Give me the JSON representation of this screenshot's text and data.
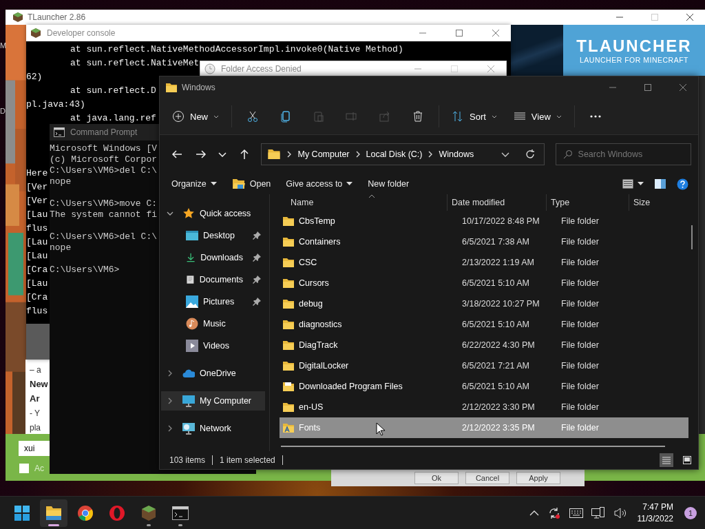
{
  "desktop": {
    "labels": [
      "M",
      "D"
    ]
  },
  "launcher": {
    "title": "TLauncher 2.86",
    "logo": {
      "title": "TLAUNCHER",
      "subtitle": "LAUNCHER FOR MINECRAFT"
    },
    "news": [
      {
        "text": "– a",
        "kind": "body"
      },
      {
        "text": "New",
        "kind": "heading"
      },
      {
        "text": "Ar",
        "kind": "heading"
      },
      {
        "text": "- Y",
        "kind": "body"
      },
      {
        "text": "pla",
        "kind": "body"
      }
    ],
    "nickname_field": {
      "value": "xui"
    },
    "account_checkbox": {
      "label": "Ac",
      "checked": false
    }
  },
  "properties_dialog": {
    "buttons": [
      "Ok",
      "Cancel",
      "Apply"
    ]
  },
  "dev_console": {
    "title": "Developer console",
    "upper_lines": [
      {
        "text": "at sun.reflect.NativeMethodAccessorImpl.invoke0(Native Method)",
        "kind": "trace"
      },
      {
        "text": "at sun.reflect.NativeMet",
        "kind": "trace"
      },
      {
        "text": "62)",
        "kind": "plain"
      },
      {
        "text": "at sun.reflect.D",
        "kind": "trace"
      },
      {
        "text": "pl.java:43)",
        "kind": "plain"
      },
      {
        "text": "at java.lang.ref",
        "kind": "trace"
      }
    ],
    "lower_lines": [
      "Here",
      "[Ver",
      "[Ver",
      "[Lau",
      "flus",
      "[Lau",
      "[Lau",
      "[Cra",
      "[Lau",
      "[Cra",
      "flus"
    ]
  },
  "access_dialog": {
    "title": "Folder Access Denied"
  },
  "cmd": {
    "title": "Command Prompt",
    "blocks": [
      [
        "Microsoft Windows [V",
        "(c) Microsoft Corpor",
        "C:\\Users\\VM6>del C:\\",
        "nope"
      ],
      [
        "C:\\Users\\VM6>move C:",
        "The system cannot fi"
      ],
      [
        "C:\\Users\\VM6>del C:\\",
        "nope"
      ],
      [
        "C:\\Users\\VM6>"
      ]
    ]
  },
  "explorer": {
    "title": "Windows",
    "toolbar": [
      {
        "kind": "new",
        "label": "New",
        "disabled": false
      },
      {
        "kind": "cut",
        "disabled": false
      },
      {
        "kind": "copy",
        "disabled": false
      },
      {
        "kind": "paste",
        "disabled": true
      },
      {
        "kind": "rename",
        "disabled": true
      },
      {
        "kind": "share",
        "disabled": true
      },
      {
        "kind": "delete",
        "disabled": false
      },
      {
        "kind": "sort",
        "label": "Sort",
        "disabled": false
      },
      {
        "kind": "view",
        "label": "View",
        "disabled": false
      },
      {
        "kind": "more",
        "disabled": false
      }
    ],
    "breadcrumb": [
      "My Computer",
      "Local Disk (C:)",
      "Windows"
    ],
    "search": {
      "placeholder": "Search Windows"
    },
    "commands": [
      {
        "label": "Organize",
        "kind": "dropdown"
      },
      {
        "label": "Open",
        "kind": "open"
      },
      {
        "label": "Give access to",
        "kind": "dropdown"
      },
      {
        "label": "New folder",
        "kind": "action"
      }
    ],
    "nav": [
      {
        "label": "Quick access",
        "kind": "quick-access",
        "expanded": true,
        "selected": false,
        "children": [
          {
            "label": "Desktop",
            "kind": "desktop",
            "pinned": true,
            "selected": false
          },
          {
            "label": "Downloads",
            "kind": "downloads",
            "pinned": true,
            "selected": false
          },
          {
            "label": "Documents",
            "kind": "documents",
            "pinned": true,
            "selected": false
          },
          {
            "label": "Pictures",
            "kind": "pictures",
            "pinned": true,
            "selected": false
          },
          {
            "label": "Music",
            "kind": "music",
            "pinned": false,
            "selected": false
          },
          {
            "label": "Videos",
            "kind": "videos",
            "pinned": false,
            "selected": false
          }
        ]
      },
      {
        "label": "OneDrive",
        "kind": "onedrive",
        "expanded": false,
        "selected": false
      },
      {
        "label": "My Computer",
        "kind": "computer",
        "expanded": false,
        "selected": true
      },
      {
        "label": "Network",
        "kind": "network",
        "expanded": false,
        "selected": false
      }
    ],
    "columns": [
      "Name",
      "Date modified",
      "Type",
      "Size"
    ],
    "files": [
      {
        "name": "CbsTemp",
        "modified": "10/17/2022 8:48 PM",
        "type": "File folder",
        "kind": "folder",
        "selected": false
      },
      {
        "name": "Containers",
        "modified": "6/5/2021 7:38 AM",
        "type": "File folder",
        "kind": "folder",
        "selected": false
      },
      {
        "name": "CSC",
        "modified": "2/13/2022 1:19 AM",
        "type": "File folder",
        "kind": "folder",
        "selected": false
      },
      {
        "name": "Cursors",
        "modified": "6/5/2021 5:10 AM",
        "type": "File folder",
        "kind": "folder",
        "selected": false
      },
      {
        "name": "debug",
        "modified": "3/18/2022 10:27 PM",
        "type": "File folder",
        "kind": "folder",
        "selected": false
      },
      {
        "name": "diagnostics",
        "modified": "6/5/2021 5:10 AM",
        "type": "File folder",
        "kind": "folder",
        "selected": false
      },
      {
        "name": "DiagTrack",
        "modified": "6/22/2022 4:30 PM",
        "type": "File folder",
        "kind": "folder",
        "selected": false
      },
      {
        "name": "DigitalLocker",
        "modified": "6/5/2021 7:21 AM",
        "type": "File folder",
        "kind": "folder",
        "selected": false
      },
      {
        "name": "Downloaded Program Files",
        "modified": "6/5/2021 5:10 AM",
        "type": "File folder",
        "kind": "program-folder",
        "selected": false
      },
      {
        "name": "en-US",
        "modified": "2/12/2022 3:30 PM",
        "type": "File folder",
        "kind": "folder",
        "selected": false
      },
      {
        "name": "Fonts",
        "modified": "2/12/2022 3:35 PM",
        "type": "File folder",
        "kind": "fonts-folder",
        "selected": true
      }
    ],
    "status": {
      "count": "103 items",
      "selection": "1 item selected"
    },
    "layout_views": [
      {
        "kind": "details",
        "selected": true
      },
      {
        "kind": "tiles",
        "selected": false
      }
    ]
  },
  "taskbar": {
    "apps": [
      {
        "kind": "start",
        "active": false,
        "running": false
      },
      {
        "kind": "explorer",
        "active": true,
        "running": true
      },
      {
        "kind": "chrome",
        "active": false,
        "running": false
      },
      {
        "kind": "opera",
        "active": false,
        "running": false
      },
      {
        "kind": "minecraft",
        "active": false,
        "running": true
      },
      {
        "kind": "cmd",
        "active": false,
        "running": true
      }
    ],
    "time": "7:47 PM",
    "date": "11/3/2022",
    "notifications": "1"
  }
}
